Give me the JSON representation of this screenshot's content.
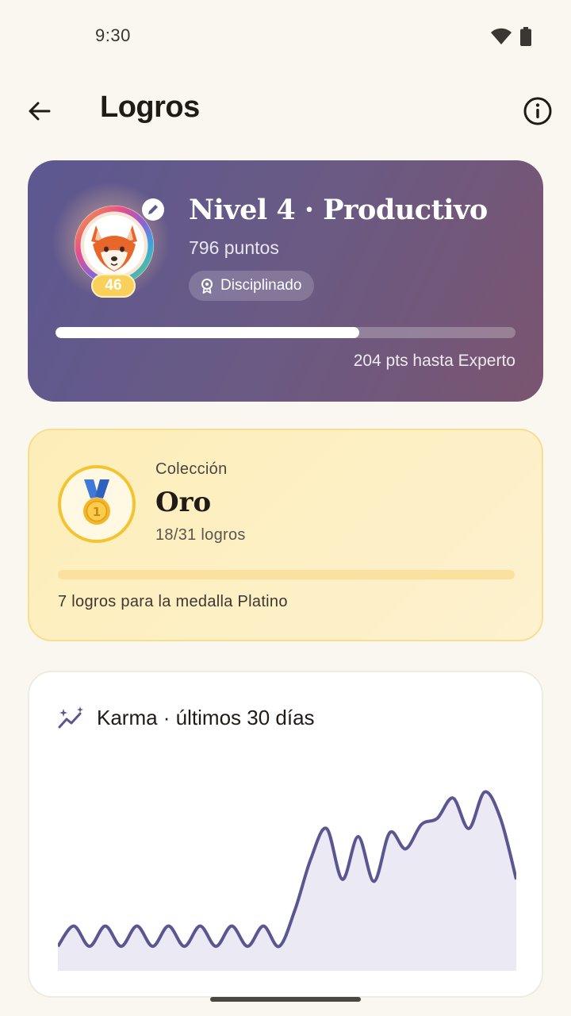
{
  "status_bar": {
    "time": "9:30"
  },
  "app_bar": {
    "title": "Logros",
    "back_icon": "arrow-back-icon",
    "info_icon": "info-icon"
  },
  "level_card": {
    "title": "Nivel 4 · Productivo",
    "points": "796 puntos",
    "chip_label": "Disciplinado",
    "avatar_level": "46",
    "progress_fraction": 0.66,
    "remaining": "204 pts hasta Experto",
    "colors": {
      "gradient_start": "#5c5891",
      "gradient_end": "#7a5570"
    }
  },
  "collection_card": {
    "label": "Colección",
    "tier": "Oro",
    "count": "18/31 logros",
    "progress_fraction": 0.0,
    "next": "7 logros para la medalla Platino",
    "colors": {
      "accent": "#f4c430",
      "background": "#fdeeb8"
    }
  },
  "karma_card": {
    "title": "Karma · últimos 30 días",
    "icon": "trend-sparkle-icon",
    "chart_data": {
      "type": "area",
      "x": [
        1,
        2,
        3,
        4,
        5,
        6,
        7,
        8,
        9,
        10,
        11,
        12,
        13,
        14,
        15,
        16,
        17,
        18,
        19,
        20,
        21,
        22,
        23,
        24,
        25,
        26,
        27,
        28,
        29,
        30
      ],
      "values": [
        12,
        22,
        12,
        22,
        12,
        22,
        12,
        22,
        12,
        22,
        12,
        22,
        12,
        22,
        12,
        30,
        55,
        70,
        45,
        66,
        44,
        68,
        60,
        72,
        75,
        85,
        70,
        88,
        75,
        45
      ],
      "grid": false,
      "line_color": "#5a5690",
      "fill_color": "#ebe9f3"
    }
  }
}
